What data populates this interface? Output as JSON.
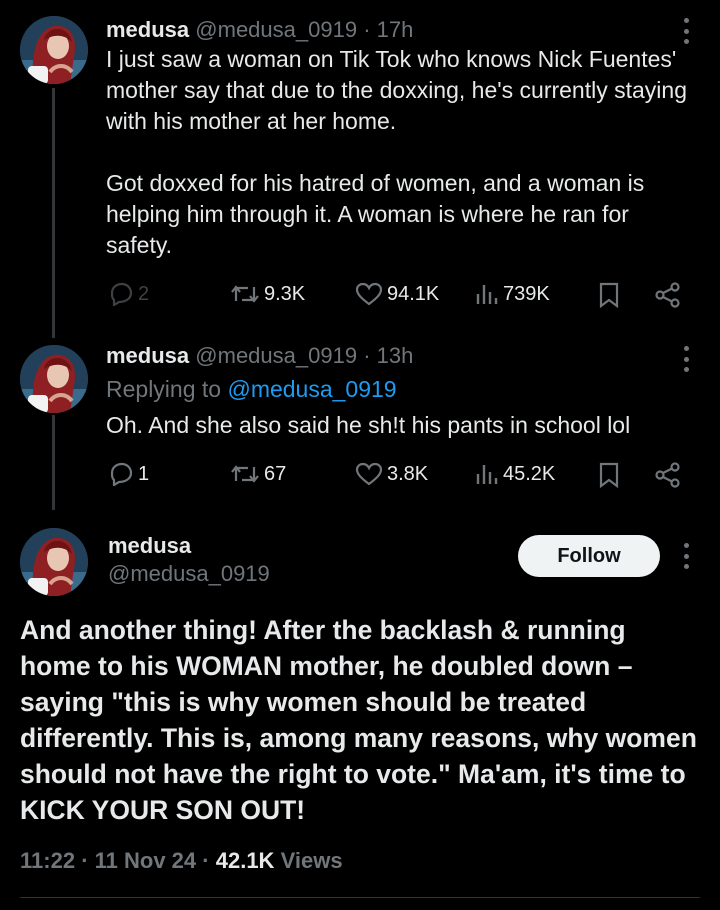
{
  "colors": {
    "background": "#000000",
    "text": "#e7e9ea",
    "muted": "#71767b",
    "link": "#1d9bf0",
    "follow_bg": "#eff3f4"
  },
  "tweets": [
    {
      "display_name": "medusa",
      "handle": "@medusa_0919",
      "separator": "·",
      "age": "17h",
      "text": "I just saw a woman on Tik Tok who knows Nick Fuentes' mother say that due to the doxxing, he's currently staying with his mother at her home.\n\nGot doxxed for his hatred of women, and a woman is helping him through it. A woman is where he ran for safety.",
      "replies": "2",
      "reposts": "9.3K",
      "likes": "94.1K",
      "views": "739K"
    },
    {
      "display_name": "medusa",
      "handle": "@medusa_0919",
      "separator": "·",
      "age": "13h",
      "replying_to_prefix": "Replying to",
      "replying_to_handle": "@medusa_0919",
      "text": "Oh. And she also said he sh!t his pants in school lol",
      "replies": "1",
      "reposts": "67",
      "likes": "3.8K",
      "views": "45.2K"
    }
  ],
  "main_tweet": {
    "display_name": "medusa",
    "handle": "@medusa_0919",
    "follow_label": "Follow",
    "text": "And another thing! After the backlash & running home to his WOMAN mother, he doubled down – saying \"this is why women should be treated differently. This is, among many reasons, why women should not have the right to vote.\" Ma'am, it's time to KICK YOUR SON OUT!",
    "time": "11:22",
    "dot": "·",
    "date": "11 Nov 24",
    "views_count": "42.1K",
    "views_label": "Views"
  },
  "icons": [
    "more-icon",
    "reply-icon",
    "repost-icon",
    "like-icon",
    "views-icon",
    "bookmark-icon",
    "share-icon"
  ]
}
